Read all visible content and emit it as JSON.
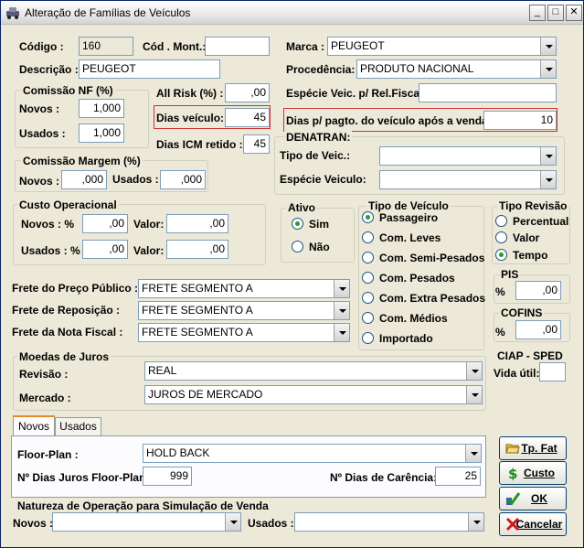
{
  "window": {
    "title": "Alteração de Famílias de Veículos",
    "minimize": "_",
    "maximize": "□",
    "close": "✕"
  },
  "fields": {
    "codigo_label": "Código :",
    "codigo": "160",
    "cod_mont_label": "Cód . Mont.:",
    "cod_mont": "",
    "descricao_label": "Descrição :",
    "descricao": "PEUGEOT",
    "marca_label": "Marca :",
    "marca": "PEUGEOT",
    "procedencia_label": "Procedência:",
    "procedencia": "PRODUTO NACIONAL",
    "especie_fiscal_label": "Espécie Veic. p/ Rel.Fiscal:",
    "especie_fiscal": "",
    "dias_pagto_label": "Dias p/ pagto. do veículo após a venda:",
    "dias_pagto": "10"
  },
  "comissao_nf": {
    "title": "Comissão NF (%)",
    "novos_label": "Novos :",
    "novos": "1,000",
    "usados_label": "Usados :",
    "usados": "1,000"
  },
  "risk": {
    "all_risk_label": "All Risk (%) :",
    "all_risk": ",00",
    "dias_veiculo_label": "Dias veículo:",
    "dias_veiculo": "45",
    "dias_icm_label": "Dias ICM retido :",
    "dias_icm": "45"
  },
  "comissao_margem": {
    "title": "Comissão Margem (%)",
    "novos_label": "Novos :",
    "novos": ",000",
    "usados_label": "Usados :",
    "usados": ",000"
  },
  "denatran": {
    "title": "DENATRAN:",
    "tipo_label": "Tipo de Veic.:",
    "tipo": "",
    "especie_label": "Espécie Veiculo:",
    "especie": ""
  },
  "custo_operacional": {
    "title": "Custo Operacional",
    "novos_label": "Novos :  %",
    "novos_pct": ",00",
    "valor_label": "Valor:",
    "novos_valor": ",00",
    "usados_label": "Usados : %",
    "usados_pct": ",00",
    "usados_valor": ",00"
  },
  "ativo": {
    "title": "Ativo",
    "sim": "Sim",
    "nao": "Não",
    "selected": "Sim"
  },
  "tipo_veiculo": {
    "title": "Tipo de Veículo",
    "options": [
      "Passageiro",
      "Com. Leves",
      "Com. Semi-Pesados",
      "Com. Pesados",
      "Com. Extra Pesados",
      "Com. Médios",
      "Importado"
    ],
    "selected": "Passageiro"
  },
  "tipo_revisao": {
    "title": "Tipo Revisão",
    "options": [
      "Percentual",
      "Valor",
      "Tempo"
    ],
    "selected": "Tempo"
  },
  "pis": {
    "title": "PIS",
    "pct_label": "%",
    "value": ",00"
  },
  "cofins": {
    "title": "COFINS",
    "pct_label": "%",
    "value": ",00"
  },
  "ciap": {
    "title": "CIAP - SPED",
    "vida_label": "Vida útil:",
    "vida": ""
  },
  "fretes": {
    "preco_publico_label": "Frete do Preço Público :",
    "preco_publico": "FRETE SEGMENTO A",
    "reposicao_label": "Frete de Reposição :",
    "reposicao": "FRETE SEGMENTO A",
    "nota_fiscal_label": "Frete da Nota Fiscal :",
    "nota_fiscal": "FRETE SEGMENTO A"
  },
  "moedas": {
    "title": "Moedas de Juros",
    "revisao_label": "Revisão :",
    "revisao": "REAL",
    "mercado_label": "Mercado :",
    "mercado": "JUROS DE MERCADO"
  },
  "tabs": {
    "novos": "Novos",
    "usados": "Usados",
    "floor_plan_label": "Floor-Plan :",
    "floor_plan": "HOLD BACK",
    "dias_juros_label": "Nº Dias Juros Floor-Plan :",
    "dias_juros": "999",
    "dias_carencia_label": "Nº Dias de Carência:",
    "dias_carencia": "25"
  },
  "natureza": {
    "title": "Natureza de Operação para Simulação de Venda",
    "novos_label": "Novos :",
    "novos": "",
    "usados_label": "Usados :",
    "usados": ""
  },
  "buttons": {
    "tp_fat": "Tp. Fat",
    "custo": "Custo",
    "ok": "OK",
    "cancelar": "Cancelar"
  },
  "colors": {
    "window_bg": "#ece9d8",
    "highlight_border": "#cc3333",
    "radio_selected": "#21a121",
    "tab_accent": "#e68b2c"
  }
}
